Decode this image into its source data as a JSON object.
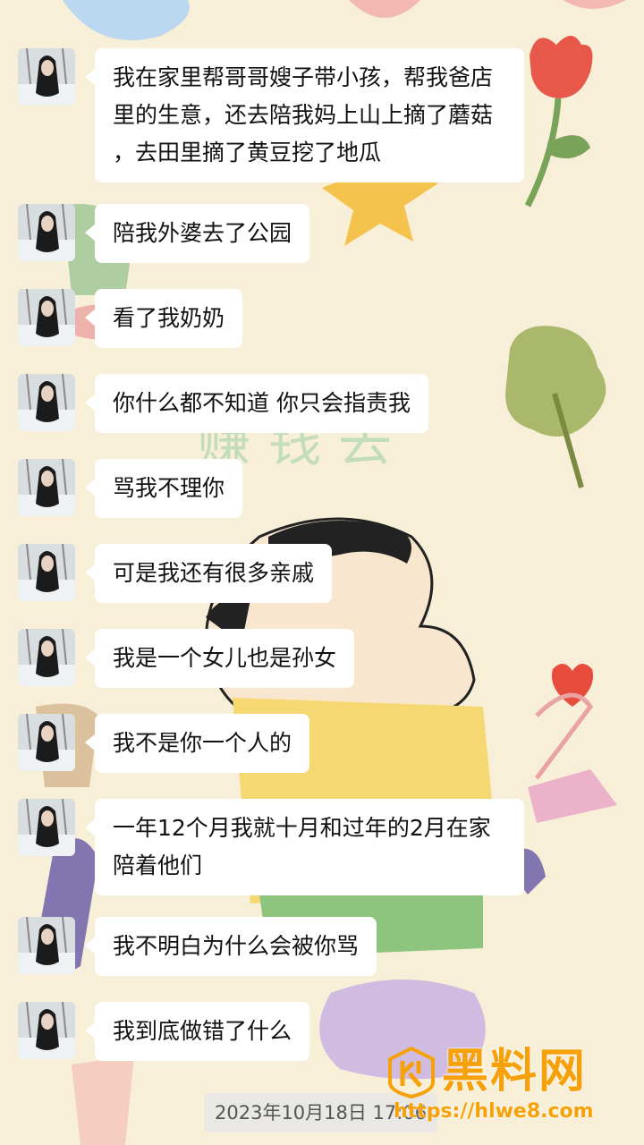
{
  "chat": {
    "messages": [
      {
        "text": "我在家里帮哥哥嫂子带小孩，帮我爸店里的生意，还去陪我妈上山上摘了蘑菇 ，去田里摘了黄豆挖了地瓜"
      },
      {
        "text": "陪我外婆去了公园"
      },
      {
        "text": "看了我奶奶"
      },
      {
        "text": "你什么都不知道 你只会指责我"
      },
      {
        "text": "骂我不理你"
      },
      {
        "text": "可是我还有很多亲戚"
      },
      {
        "text": "我是一个女儿也是孙女"
      },
      {
        "text": "我不是你一个人的"
      },
      {
        "text": "一年12个月我就十月和过年的2月在家陪着他们"
      },
      {
        "text": "我不明白为什么会被你骂"
      },
      {
        "text": "我到底做错了什么"
      }
    ],
    "timestamp": "2023年10月18日 17:06"
  },
  "watermark": {
    "title": "黑料网",
    "url": "https://hlwe8.com"
  },
  "colors": {
    "background": "#f8efd8",
    "bubble": "#ffffff",
    "watermark": "#f7a10a"
  }
}
